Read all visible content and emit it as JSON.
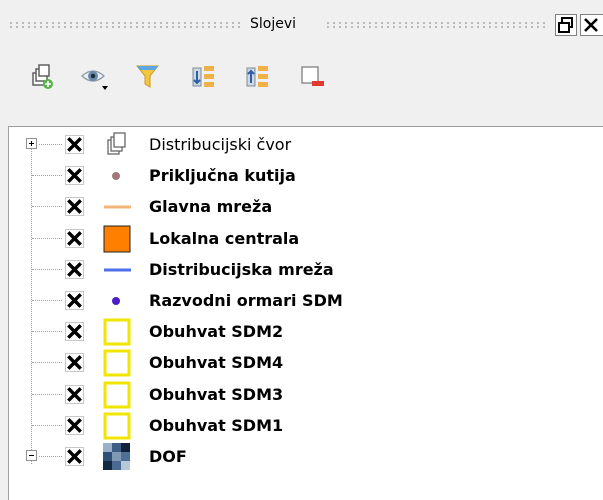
{
  "panel": {
    "title": "Slojevi"
  },
  "toolbar": {
    "items": [
      {
        "name": "add-group-icon"
      },
      {
        "name": "eye-visibility-icon"
      },
      {
        "name": "filter-legend-icon"
      },
      {
        "name": "expand-all-icon"
      },
      {
        "name": "collapse-all-icon"
      },
      {
        "name": "remove-layer-icon"
      }
    ]
  },
  "layers": [
    {
      "label": "Distribucijski čvor",
      "checked": true,
      "symbol": "group-icon",
      "expander": "plus",
      "bold": false
    },
    {
      "label": "Priključna kutija",
      "checked": true,
      "symbol": "point",
      "color": "#a07878",
      "bold": true
    },
    {
      "label": "Glavna mreža",
      "checked": true,
      "symbol": "line",
      "color": "#f3b577",
      "bold": true
    },
    {
      "label": "Lokalna centrala",
      "checked": true,
      "symbol": "square",
      "color": "#ff7f00",
      "bold": true
    },
    {
      "label": "Distribucijska mreža",
      "checked": true,
      "symbol": "line",
      "color": "#4d6fe8",
      "bold": true
    },
    {
      "label": "Razvodni ormari SDM",
      "checked": true,
      "symbol": "point",
      "color": "#4b1ecc",
      "bold": true
    },
    {
      "label": "Obuhvat SDM2",
      "checked": true,
      "symbol": "outline",
      "color": "#f2e600",
      "bold": true
    },
    {
      "label": "Obuhvat SDM4",
      "checked": true,
      "symbol": "outline",
      "color": "#f2e600",
      "bold": true
    },
    {
      "label": "Obuhvat SDM3",
      "checked": true,
      "symbol": "outline",
      "color": "#f2e600",
      "bold": true
    },
    {
      "label": "Obuhvat SDM1",
      "checked": true,
      "symbol": "outline",
      "color": "#f2e600",
      "bold": true
    },
    {
      "label": "DOF",
      "checked": true,
      "symbol": "raster",
      "expander": "minus",
      "bold": true
    }
  ]
}
